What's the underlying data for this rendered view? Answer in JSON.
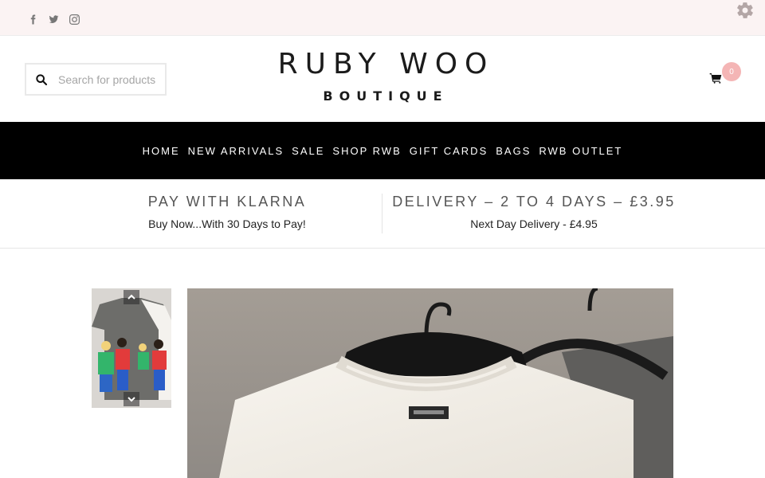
{
  "topbar": {
    "social": [
      {
        "name": "facebook-icon"
      },
      {
        "name": "twitter-icon"
      },
      {
        "name": "instagram-icon"
      }
    ],
    "settings_icon": "gear-icon"
  },
  "header": {
    "search_placeholder": "Search for products",
    "logo_line1": "RUBY WOO",
    "logo_line2": "BOUTIQUE",
    "cart_count": "0"
  },
  "nav": {
    "items": [
      "HOME",
      "NEW ARRIVALS",
      "SALE",
      "SHOP RWB",
      "GIFT CARDS",
      "BAGS",
      "RWB OUTLET"
    ]
  },
  "promo": {
    "left_heading": "PAY WITH KLARNA",
    "left_sub": "Buy Now...With 30 Days to Pay!",
    "right_heading": "DELIVERY – 2 TO 4 DAYS – £3.95",
    "right_sub": "Next Day Delivery - £4.95"
  },
  "colors": {
    "topbar_bg": "#fbf3f3",
    "nav_bg": "#000000",
    "cart_badge": "#f4b5b5"
  }
}
